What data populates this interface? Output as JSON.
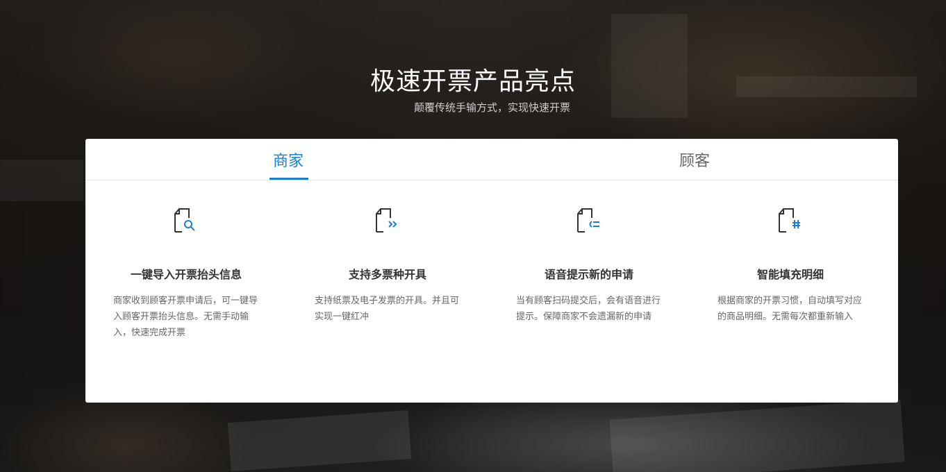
{
  "hero": {
    "title": "极速开票产品亮点",
    "subtitle": "颠覆传统手输方式，实现快速开票"
  },
  "tabs": [
    {
      "label": "商家",
      "active": true
    },
    {
      "label": "顾客",
      "active": false
    }
  ],
  "colors": {
    "accent": "#1a7fd0",
    "title_text": "#333333",
    "body_text": "#666666"
  },
  "features": [
    {
      "icon": "document-search-icon",
      "title": "一键导入开票抬头信息",
      "description": "商家收到顾客开票申请后，可一键导入顾客开票抬头信息。无需手动输入，快速完成开票"
    },
    {
      "icon": "document-forward-icon",
      "title": "支持多票种开具",
      "description": "支持纸票及电子发票的开具。并且可实现一键红冲"
    },
    {
      "icon": "document-voice-icon",
      "title": "语音提示新的申请",
      "description": "当有顾客扫码提交后，会有语音进行提示。保障商家不会遗漏新的申请"
    },
    {
      "icon": "document-autofill-icon",
      "title": "智能填充明细",
      "description": "根据商家的开票习惯，自动填写对应的商品明细。无需每次都重新输入"
    }
  ]
}
